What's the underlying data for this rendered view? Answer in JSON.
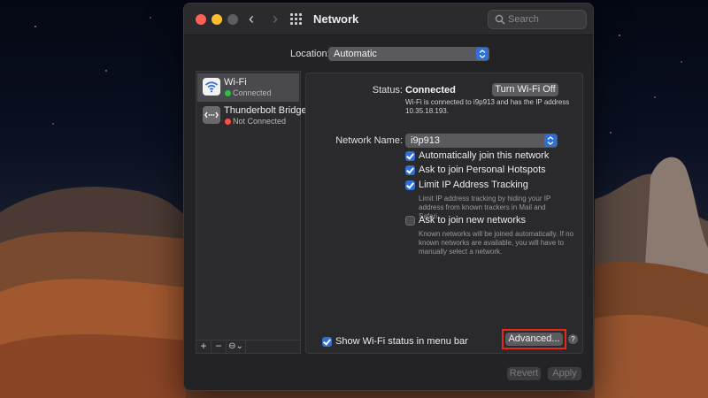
{
  "window": {
    "title": "Network",
    "search_placeholder": "Search"
  },
  "location": {
    "label": "Location:",
    "value": "Automatic"
  },
  "services": [
    {
      "name": "Wi-Fi",
      "status": "Connected",
      "icon": "wifi-icon",
      "status_color": "#2fbf4a"
    },
    {
      "name": "Thunderbolt Bridge",
      "status": "Not Connected",
      "icon": "thunderbolt-bridge-icon",
      "status_color": "#ff4d4a"
    }
  ],
  "sidebar_controls": {
    "add": "+",
    "remove": "−",
    "action": "⊖⌄"
  },
  "detail": {
    "status_label": "Status:",
    "status_value": "Connected",
    "toggle_button": "Turn Wi-Fi Off",
    "status_description": "Wi-Fi is connected to i9p913 and has the IP address 10.35.18.193.",
    "network_name_label": "Network Name:",
    "network_name_value": "i9p913",
    "options": [
      {
        "label": "Automatically join this network",
        "checked": true
      },
      {
        "label": "Ask to join Personal Hotspots",
        "checked": true
      },
      {
        "label": "Limit IP Address Tracking",
        "checked": true
      },
      {
        "label": "Ask to join new networks",
        "checked": false
      }
    ],
    "limit_ip_hint": "Limit IP address tracking by hiding your IP address from known trackers in Mail and Safari.",
    "ask_join_hint": "Known networks will be joined automatically. If no known networks are available, you will have to manually select a network.",
    "show_status_label": "Show Wi-Fi status in menu bar",
    "show_status_checked": true,
    "advanced_button": "Advanced...",
    "help": "?"
  },
  "footer": {
    "revert": "Revert",
    "apply": "Apply"
  },
  "colors": {
    "accent": "#2f6fd8",
    "highlight": "#e8271d"
  }
}
